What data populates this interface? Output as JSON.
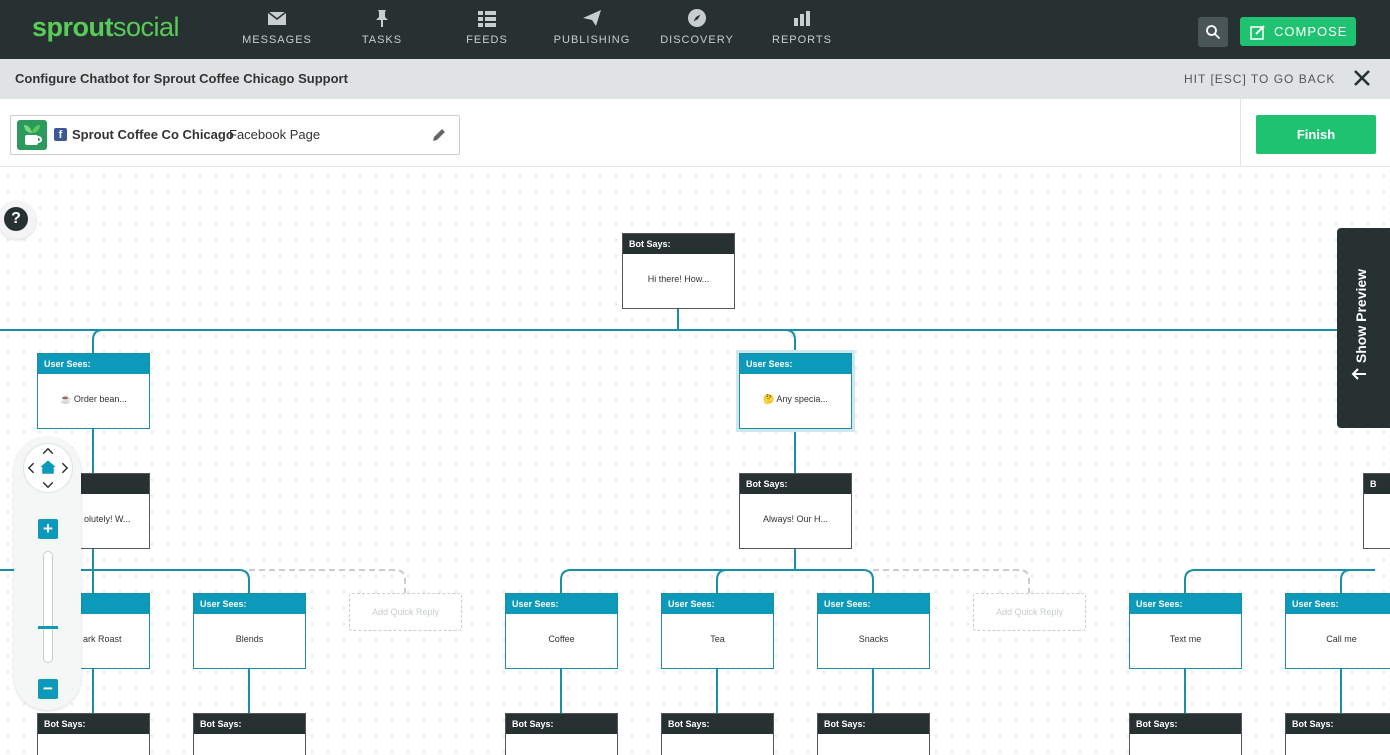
{
  "brand": {
    "part1": "sprout",
    "part2": "social"
  },
  "nav": [
    {
      "label": "MESSAGES",
      "icon": "envelope-icon"
    },
    {
      "label": "TASKS",
      "icon": "pin-icon"
    },
    {
      "label": "FEEDS",
      "icon": "list-icon"
    },
    {
      "label": "PUBLISHING",
      "icon": "paper-plane-icon"
    },
    {
      "label": "DISCOVERY",
      "icon": "compass-icon"
    },
    {
      "label": "REPORTS",
      "icon": "bar-chart-icon"
    }
  ],
  "compose_label": "COMPOSE",
  "titlebar": {
    "title": "Configure Chatbot for Sprout Coffee Chicago Support",
    "esc": "HIT [ESC] TO GO BACK"
  },
  "page": {
    "name": "Sprout Coffee Co Chicago",
    "type": "Facebook Page"
  },
  "finish_label": "Finish",
  "preview_label": "Show Preview",
  "help_label": "?",
  "quick_reply_label": "Add Quick Reply",
  "nodes": {
    "root": {
      "head": "Bot Says:",
      "body": "Hi there! How..."
    },
    "u1": {
      "head": "User Sees:",
      "body": "☕ Order bean..."
    },
    "u2": {
      "head": "User Sees:",
      "body": "🤔 Any specia..."
    },
    "b1": {
      "head": "",
      "body": "olutely! W..."
    },
    "b2": {
      "head": "Bot Says:",
      "body": "Always! Our H..."
    },
    "b3": {
      "head": "B",
      "body": ""
    },
    "l1": {
      "head": "",
      "body": "ark Roast"
    },
    "l2": {
      "head": "User Sees:",
      "body": "Blends"
    },
    "l3": {
      "head": "User Sees:",
      "body": "Coffee"
    },
    "l4": {
      "head": "User Sees:",
      "body": "Tea"
    },
    "l5": {
      "head": "User Sees:",
      "body": "Snacks"
    },
    "l6": {
      "head": "User Sees:",
      "body": "Text me"
    },
    "l7": {
      "head": "User Sees:",
      "body": "Call me"
    },
    "bottom": "Bot Says:"
  }
}
